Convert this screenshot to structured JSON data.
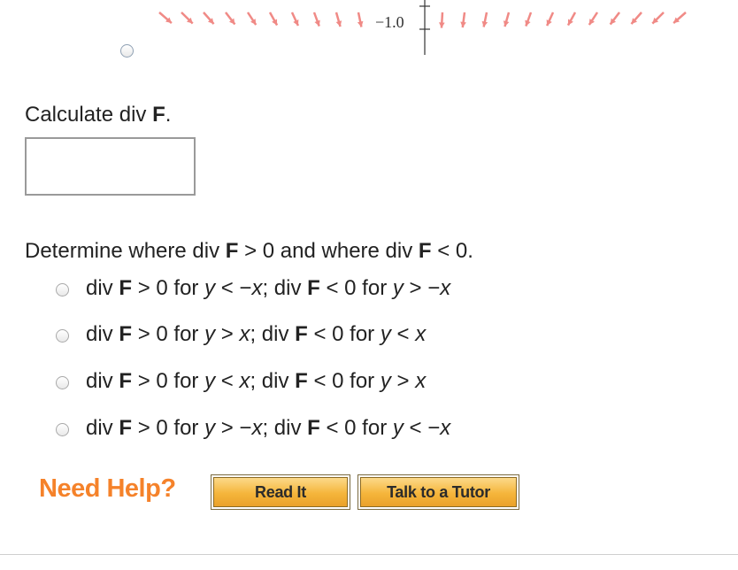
{
  "figure": {
    "axis_tick_label": "−1.0"
  },
  "question1": {
    "prompt_text": "Calculate div ",
    "prompt_bold": "F",
    "prompt_end": ".",
    "answer_value": ""
  },
  "question2": {
    "prompt_a": "Determine where div ",
    "prompt_b": "F",
    "prompt_c": " > 0 and where div ",
    "prompt_d": "F",
    "prompt_e": " < 0.",
    "choices": [
      {
        "a": "div ",
        "b": "F",
        "c": " > 0 for ",
        "d": "y",
        "e": " < −",
        "f": "x",
        "g": "; div ",
        "h": "F",
        "i": " < 0 for ",
        "j": "y",
        "k": " > −",
        "l": "x"
      },
      {
        "a": "div ",
        "b": "F",
        "c": " > 0 for ",
        "d": "y",
        "e": " > ",
        "f": "x",
        "g": "; div ",
        "h": "F",
        "i": " < 0 for ",
        "j": "y",
        "k": " < ",
        "l": "x"
      },
      {
        "a": "div ",
        "b": "F",
        "c": " > 0 for ",
        "d": "y",
        "e": " < ",
        "f": "x",
        "g": "; div ",
        "h": "F",
        "i": " < 0 for ",
        "j": "y",
        "k": " > ",
        "l": "x"
      },
      {
        "a": "div ",
        "b": "F",
        "c": " > 0 for ",
        "d": "y",
        "e": " > −",
        "f": "x",
        "g": "; div ",
        "h": "F",
        "i": " < 0 for ",
        "j": "y",
        "k": " < −",
        "l": "x"
      }
    ]
  },
  "help": {
    "label": "Need Help?",
    "read_it": "Read It",
    "talk_to_tutor": "Talk to a Tutor"
  },
  "colors": {
    "arrow": "#f08a86",
    "help_label": "#f5822a",
    "button": "#f5b53b"
  }
}
